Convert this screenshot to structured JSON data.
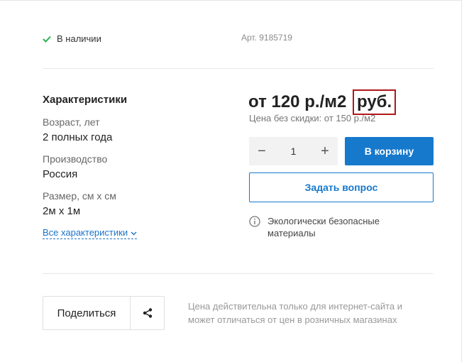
{
  "stock": {
    "label": "В наличии"
  },
  "sku": "Арт. 9185719",
  "characteristics": {
    "title": "Характеристики",
    "items": [
      {
        "label": "Возраст, лет",
        "value": "2 полных года"
      },
      {
        "label": "Производство",
        "value": "Россия"
      },
      {
        "label": "Размер, см х см",
        "value": "2м х 1м"
      }
    ],
    "all_link": "Все характеристики"
  },
  "price": {
    "main": "от 120 р./м2",
    "currency": "руб.",
    "old": "Цена без скидки: от 150 р./м2"
  },
  "quantity": {
    "minus": "−",
    "value": "1",
    "plus": "+"
  },
  "buttons": {
    "cart": "В корзину",
    "ask": "Задать вопрос"
  },
  "eco_note": "Экологически безопасные материалы",
  "share": {
    "label": "Поделиться"
  },
  "disclaimer": "Цена действительна только для интернет-сайта и может отличаться от цен в розничных магазинах",
  "colors": {
    "accent": "#1679cc",
    "check": "#2bb24c",
    "highlight": "#b1171b"
  }
}
